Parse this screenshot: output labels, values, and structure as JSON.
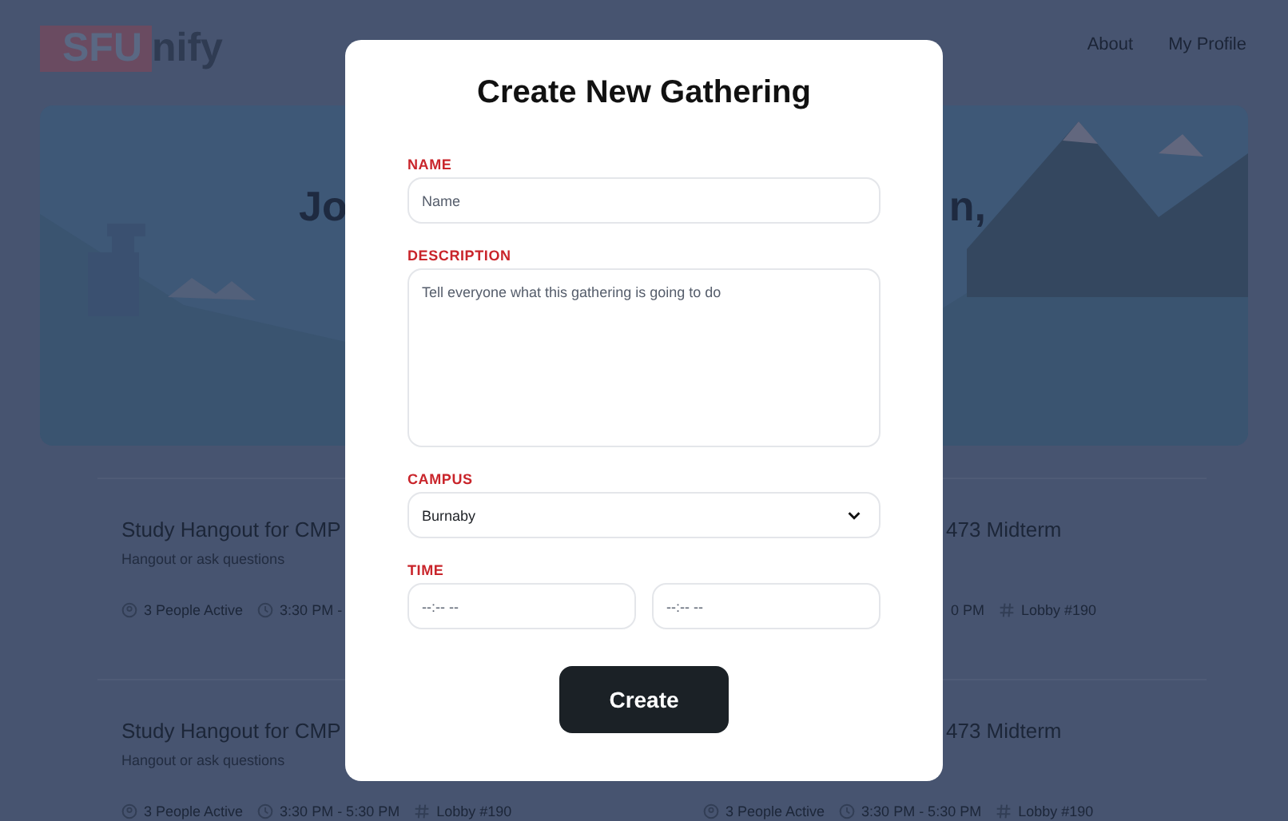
{
  "header": {
    "logo": {
      "highlight": "SFU",
      "rest": "nify"
    },
    "nav": [
      "About",
      "My Profile"
    ]
  },
  "hero": {
    "heading_fragments": [
      "Jo",
      "n,"
    ]
  },
  "cards": [
    {
      "title": "Study Hangout for CMP",
      "subtitle": "Hangout or ask questions",
      "meta": [
        {
          "kind": "people",
          "text": "3 People Active"
        },
        {
          "kind": "time",
          "text": "3:30 PM -"
        }
      ]
    },
    {
      "title": "473 Midterm",
      "meta": [
        {
          "kind": "text",
          "text": "0 PM"
        },
        {
          "kind": "room",
          "text": "Lobby #190"
        }
      ]
    },
    {
      "title": "Study Hangout for CMP",
      "subtitle": "Hangout or ask questions",
      "meta": [
        {
          "kind": "people",
          "text": "3 People Active"
        },
        {
          "kind": "time",
          "text": "3:30 PM - 5:30 PM"
        },
        {
          "kind": "room",
          "text": "Lobby #190"
        }
      ]
    },
    {
      "title": "473 Midterm",
      "meta": [
        {
          "kind": "people",
          "text": "3 People Active"
        },
        {
          "kind": "time",
          "text": "3:30 PM - 5:30 PM"
        },
        {
          "kind": "room",
          "text": "Lobby #190"
        }
      ]
    }
  ],
  "modal": {
    "title": "Create New Gathering",
    "fields": [
      {
        "kind": "text",
        "label": "NAME",
        "placeholder": "Name"
      },
      {
        "kind": "textarea",
        "label": "DESCRIPTION",
        "placeholder": "Tell everyone what this gathering is going to do"
      },
      {
        "kind": "select",
        "label": "CAMPUS",
        "value": "Burnaby"
      },
      {
        "kind": "time-pair",
        "label": "TIME",
        "placeholders": [
          "--:-- --",
          "--:-- --"
        ]
      }
    ],
    "submit": "Create"
  }
}
